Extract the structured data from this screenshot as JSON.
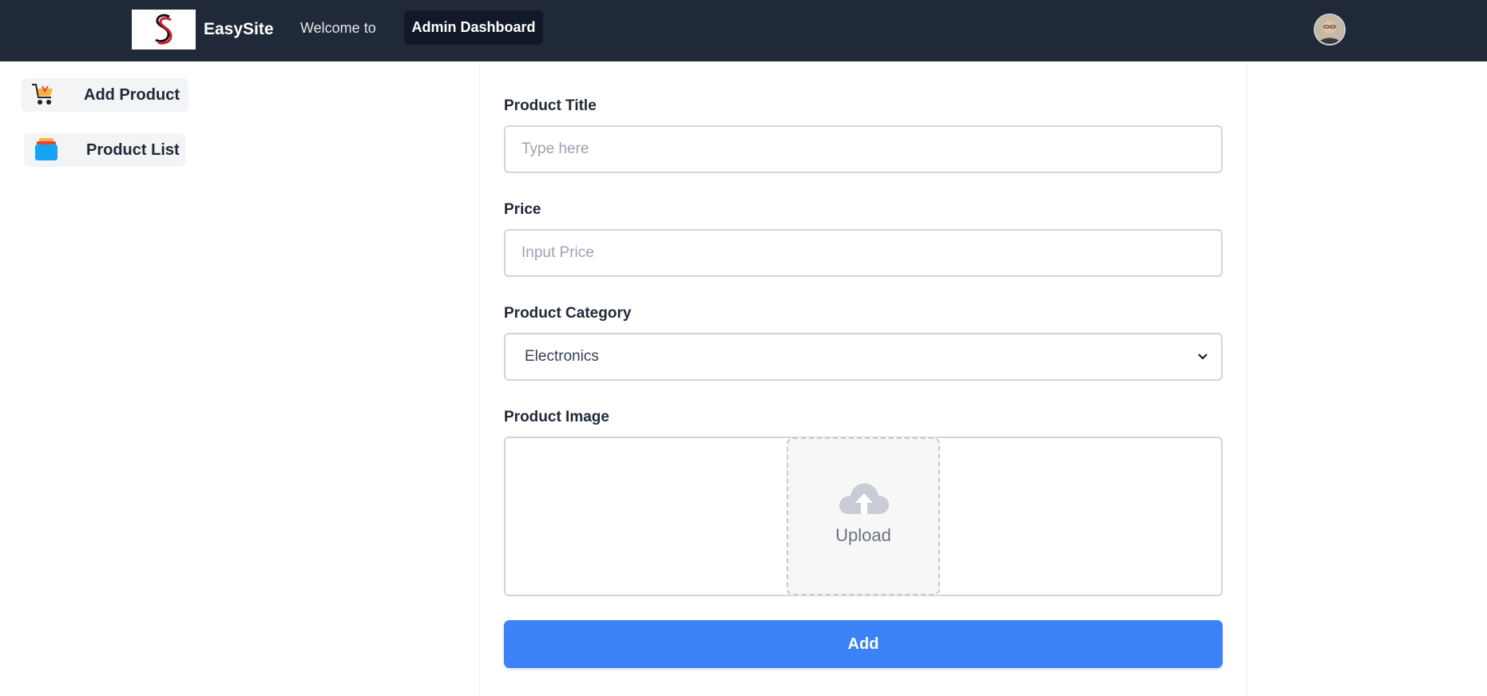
{
  "header": {
    "brand": "EasySite",
    "welcome": "Welcome to",
    "dashboard_label": "Admin Dashboard",
    "logo_icon": "s-logo-icon",
    "avatar_icon": "user-avatar"
  },
  "sidebar": {
    "items": [
      {
        "label": "Add Product",
        "icon": "shopping-cart-icon"
      },
      {
        "label": "Product List",
        "icon": "stack-icon"
      }
    ]
  },
  "form": {
    "title_label": "Product Title",
    "title_placeholder": "Type here",
    "price_label": "Price",
    "price_placeholder": "Input Price",
    "category_label": "Product Category",
    "category_selected": "Electronics",
    "image_label": "Product Image",
    "upload_text": "Upload",
    "submit_label": "Add"
  },
  "colors": {
    "header_bg": "#1f2937",
    "accent": "#3b82f6"
  }
}
